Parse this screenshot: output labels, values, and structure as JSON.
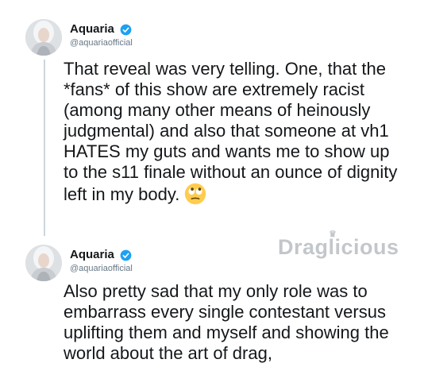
{
  "tweets": [
    {
      "display_name": "Aquaria",
      "handle": "@aquariaofficial",
      "text": "That reveal was very telling. One, that the *fans* of this show are extremely racist (among many other means of heinously judgmental) and also that someone at vh1 HATES my guts and wants me to show up to the s11 finale without an ounce of dignity left in my body.",
      "emoji": "face-with-rolling-eyes-icon"
    },
    {
      "display_name": "Aquaria",
      "handle": "@aquariaofficial",
      "text": "Also pretty sad that my only role was to embarrass every single contestant versus uplifting them and myself and showing the world about the art of drag,"
    }
  ],
  "watermark": {
    "text": "Draglicious"
  },
  "colors": {
    "verified": "#1da1f2",
    "handle": "#657786",
    "text": "#14171a",
    "thread_line": "#ccd6dd"
  }
}
